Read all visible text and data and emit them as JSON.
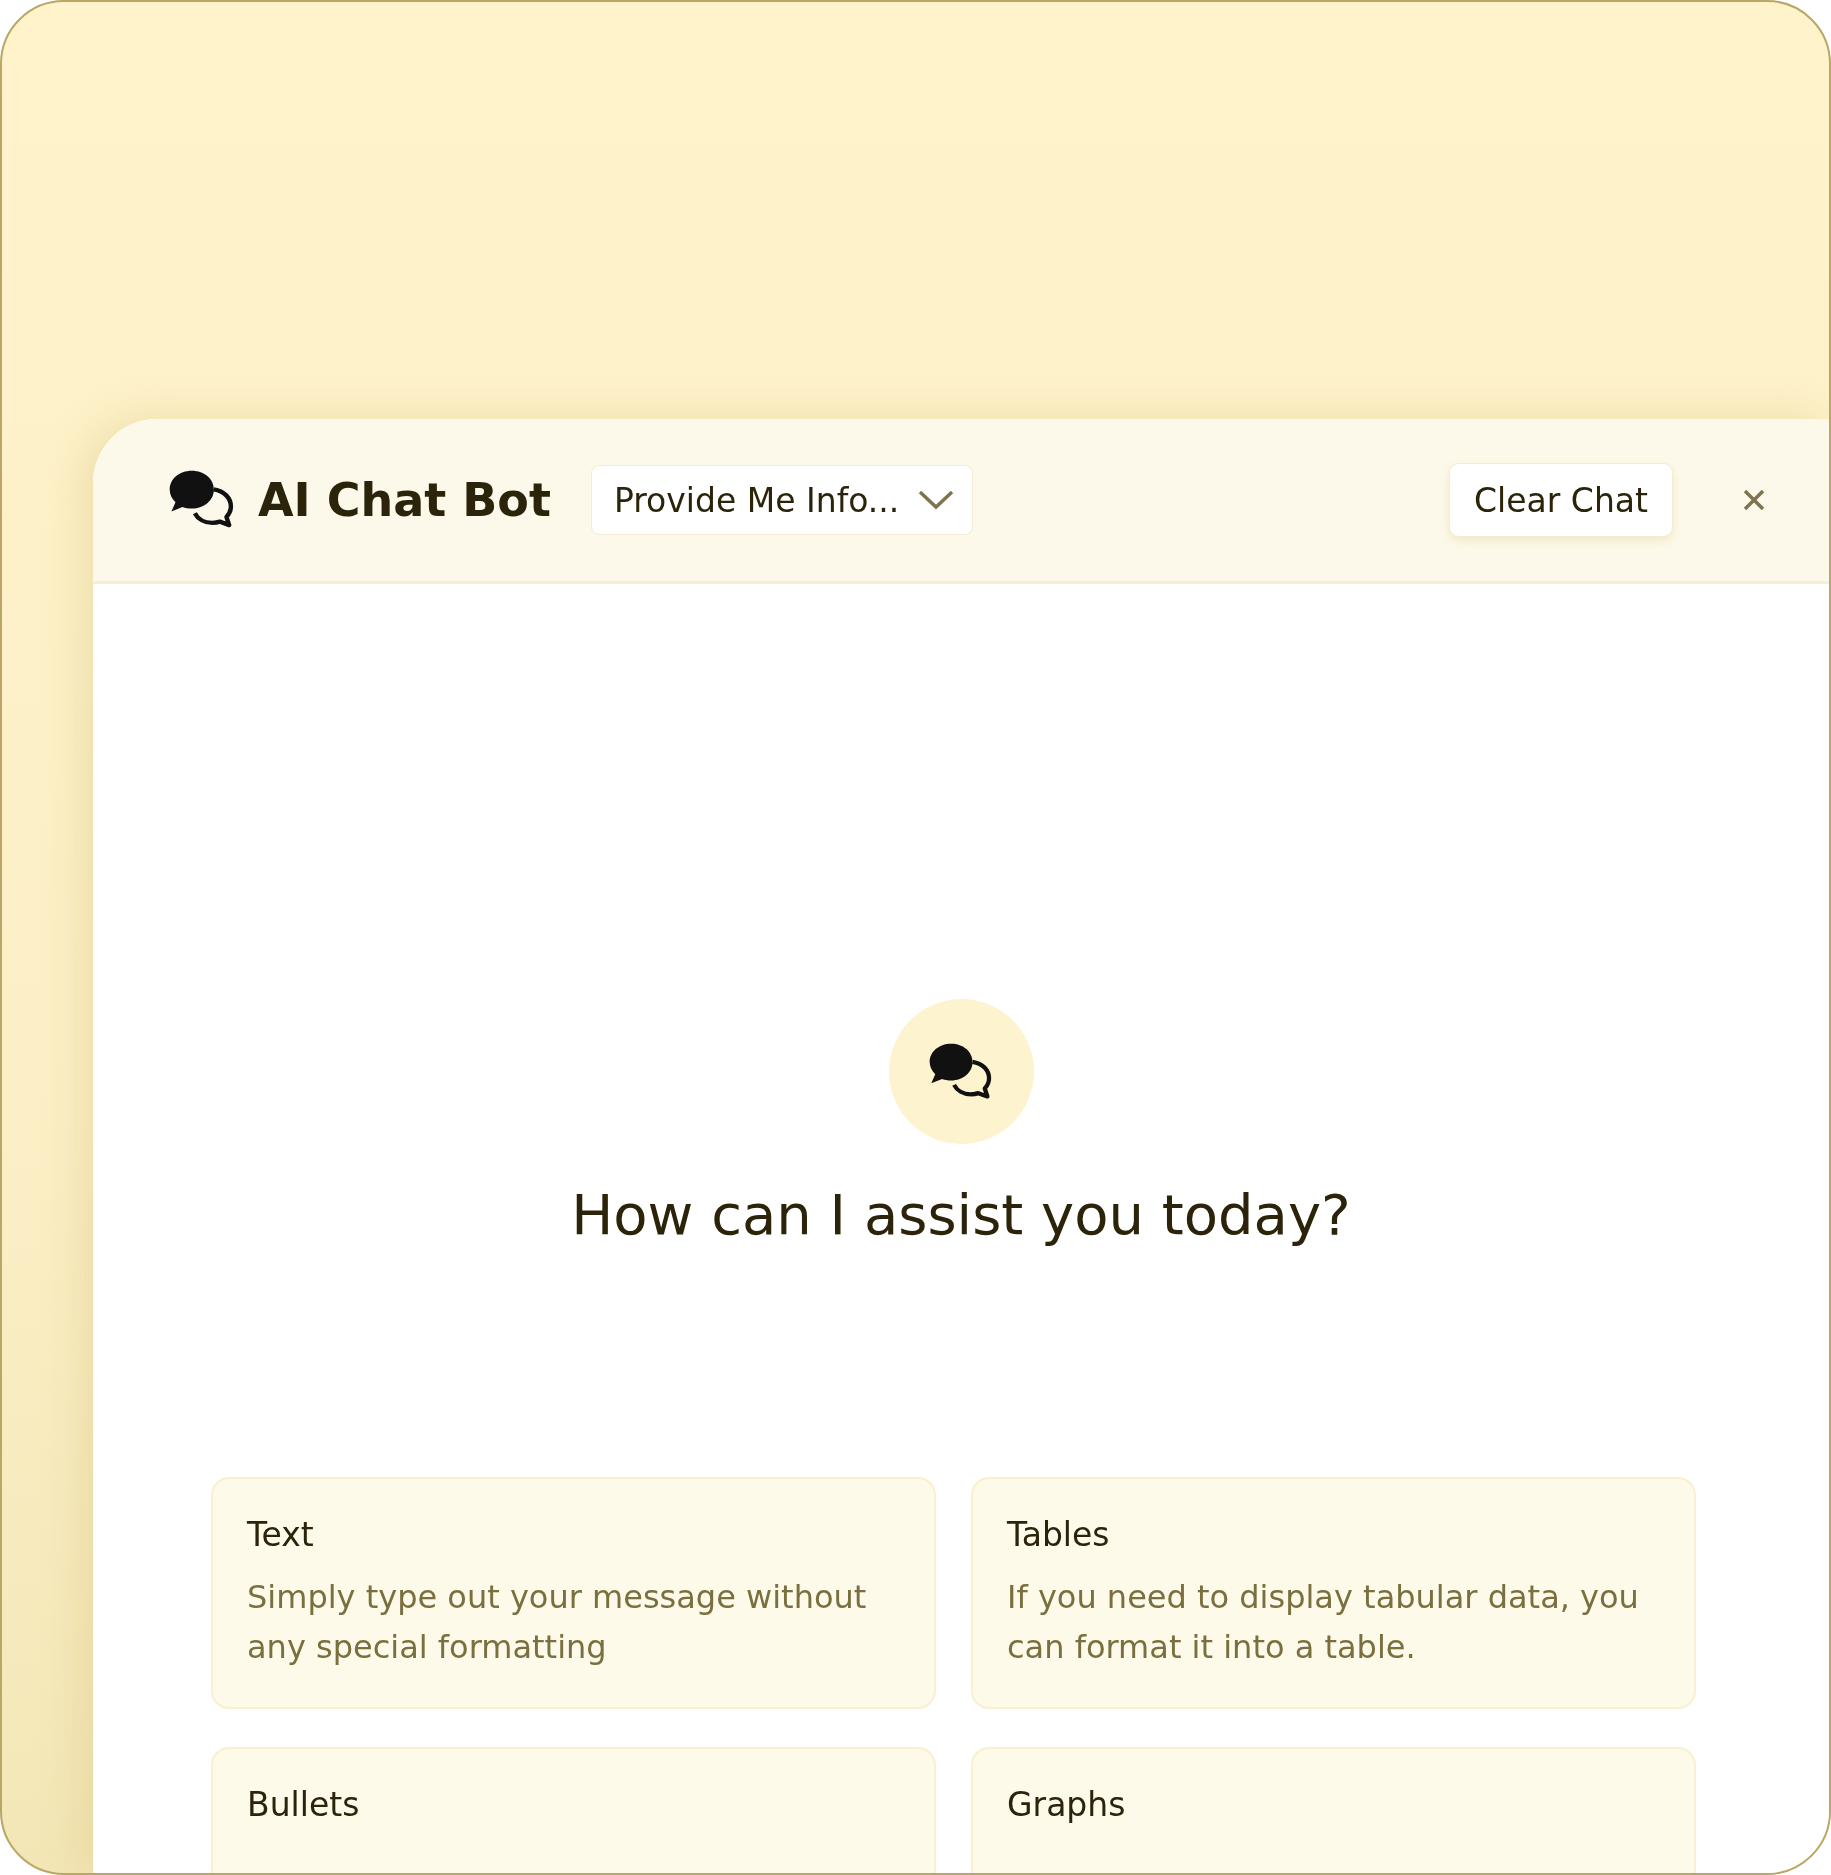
{
  "header": {
    "title": "AI Chat Bot",
    "dropdown": {
      "value": "Provide Me Info..."
    },
    "clear_button": "Clear Chat"
  },
  "welcome": {
    "heading": "How can I assist you today?"
  },
  "cards": [
    {
      "title": "Text",
      "description": "Simply type out your message without any special formatting"
    },
    {
      "title": "Tables",
      "description": "If you need to display tabular data, you can format it into a table."
    },
    {
      "title": "Bullets"
    },
    {
      "title": "Graphs"
    }
  ]
}
